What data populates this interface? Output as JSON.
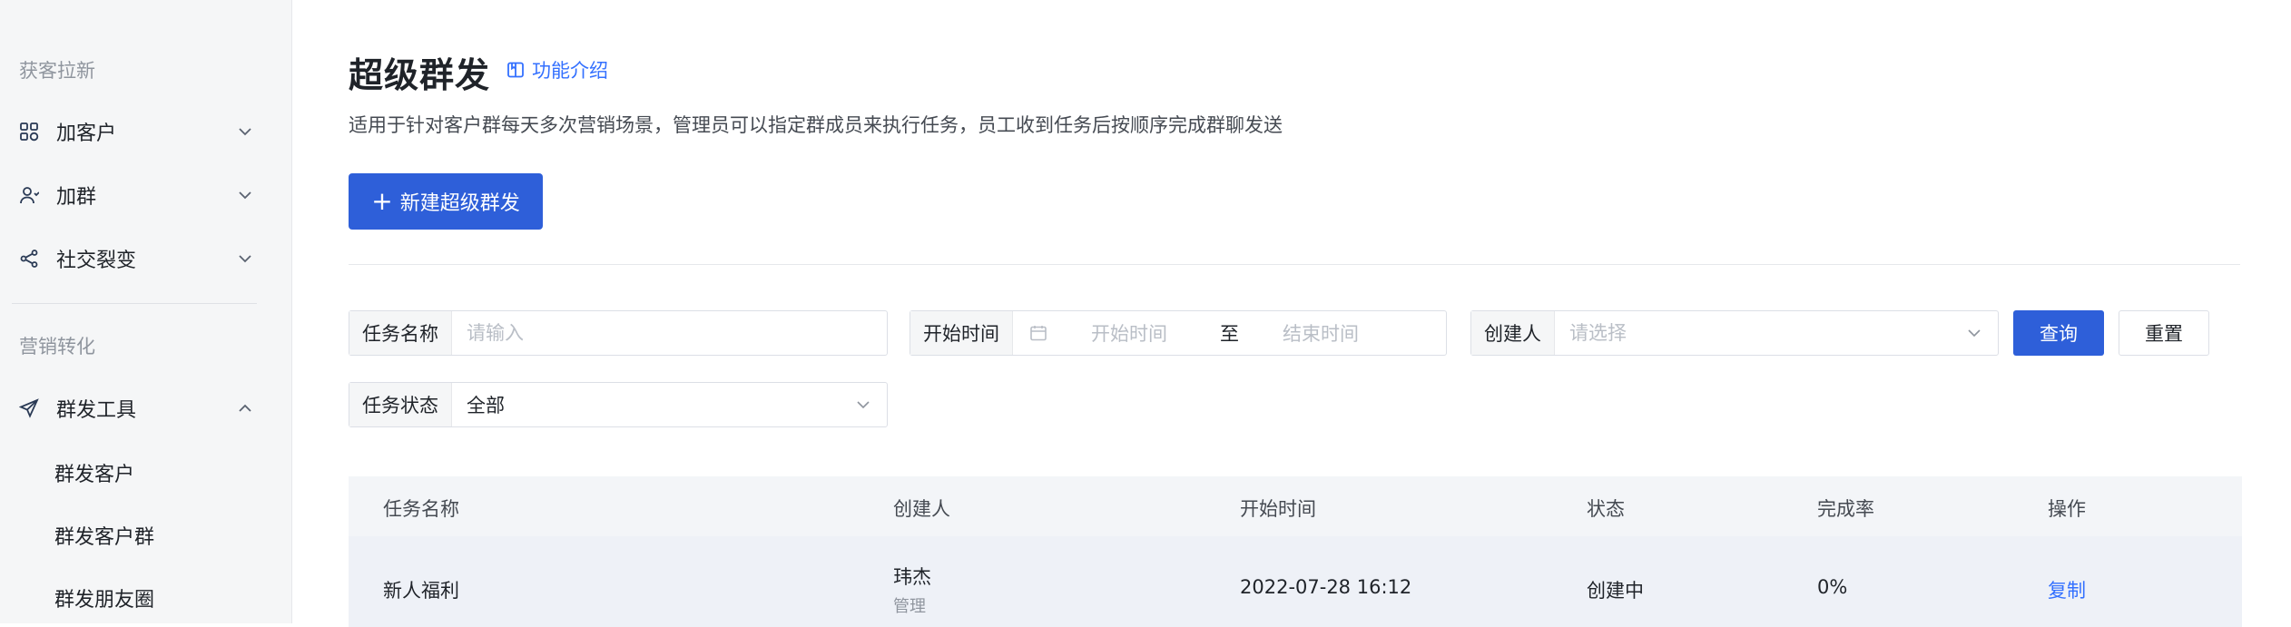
{
  "sidebar": {
    "section1_title": "获客拉新",
    "section2_title": "营销转化",
    "items": [
      {
        "label": "加客户"
      },
      {
        "label": "加群"
      },
      {
        "label": "社交裂变"
      },
      {
        "label": "群发工具"
      }
    ],
    "sub_items": [
      {
        "label": "群发客户"
      },
      {
        "label": "群发客户群"
      },
      {
        "label": "群发朋友圈"
      }
    ]
  },
  "header": {
    "title": "超级群发",
    "intro_link": "功能介绍",
    "description": "适用于针对客户群每天多次营销场景，管理员可以指定群成员来执行任务，员工收到任务后按顺序完成群聊发送",
    "new_button": "新建超级群发"
  },
  "filters": {
    "task_name_label": "任务名称",
    "task_name_placeholder": "请输入",
    "start_time_label": "开始时间",
    "start_placeholder": "开始时间",
    "date_sep": "至",
    "end_placeholder": "结束时间",
    "creator_label": "创建人",
    "creator_placeholder": "请选择",
    "status_label": "任务状态",
    "status_value": "全部",
    "query_button": "查询",
    "reset_button": "重置"
  },
  "table": {
    "columns": [
      "任务名称",
      "创建人",
      "开始时间",
      "状态",
      "完成率",
      "操作"
    ],
    "rows": [
      {
        "name": "新人福利",
        "creator": "玮杰",
        "creator_role": "管理",
        "start_time": "2022-07-28 16:12",
        "status": "创建中",
        "rate": "0%",
        "action": "复制"
      }
    ]
  },
  "colors": {
    "accent": "#2e5fd9",
    "link": "#3370ff",
    "sidebar_bg": "#f5f6f7"
  }
}
